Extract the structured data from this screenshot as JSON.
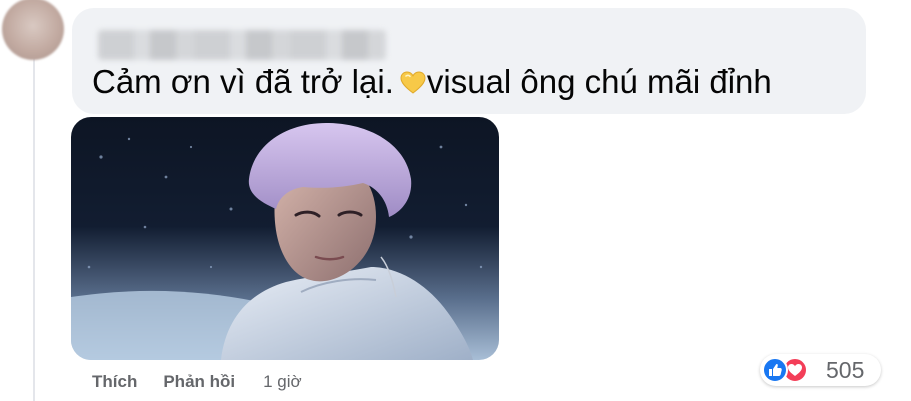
{
  "comment": {
    "text_before_emoji": "Cảm ơn vì đã trở lại.",
    "emoji": "yellow-heart-icon",
    "text_after_emoji": "visual ông chú mãi đỉnh"
  },
  "actions": {
    "like_label": "Thích",
    "reply_label": "Phản hồi",
    "timestamp": "1 giờ"
  },
  "reactions": {
    "icons": [
      "like-icon",
      "love-icon"
    ],
    "count": "505"
  },
  "colors": {
    "bubble": "#f0f2f5",
    "muted_text": "#65676b",
    "like_blue": "#1877f2",
    "love_red": "#f33e58",
    "yellow_heart": "#f7c948"
  }
}
